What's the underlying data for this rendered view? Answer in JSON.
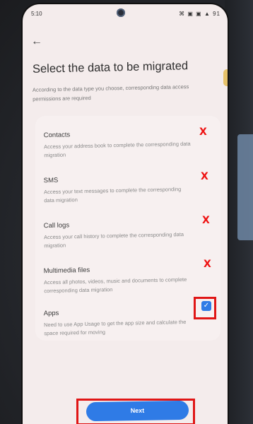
{
  "status_bar": {
    "time": "5:10",
    "icons": "⌘ ▣ ▣ ▲ 91"
  },
  "header": {
    "back_icon": "←",
    "title": "Select the data to be migrated",
    "subtitle": "According to the data type you choose, corresponding data access permissions are required"
  },
  "items": [
    {
      "title": "Contacts",
      "description": "Access your address book to complete the corresponding data migration",
      "selected": false,
      "mark": "X"
    },
    {
      "title": "SMS",
      "description": "Access your text messages to complete the corresponding data migration",
      "selected": false,
      "mark": "X"
    },
    {
      "title": "Call logs",
      "description": "Access your call history to complete the corresponding data migration",
      "selected": false,
      "mark": "X"
    },
    {
      "title": "Multimedia files",
      "description": "Access all photos, videos, music and documents to complete corresponding data migration",
      "selected": false,
      "mark": "X"
    },
    {
      "title": "Apps",
      "description": "Need to use App Usage to get the app size and calculate the space required for moving",
      "selected": true,
      "mark": "✓"
    }
  ],
  "footer": {
    "next_label": "Next"
  },
  "colors": {
    "accent": "#2f7be6",
    "highlight": "#e01616"
  }
}
